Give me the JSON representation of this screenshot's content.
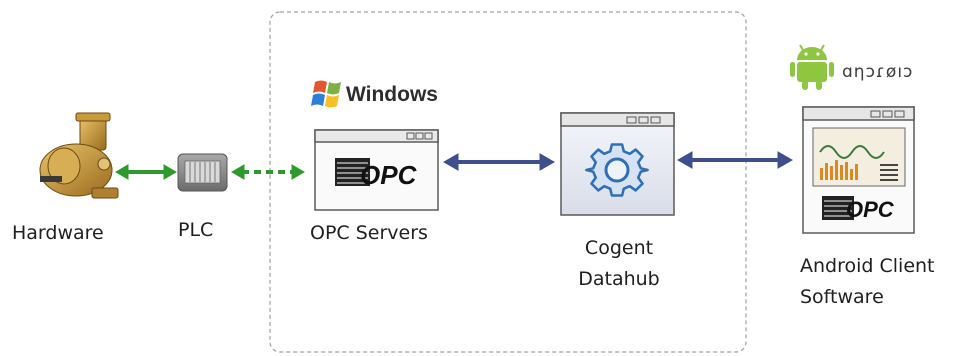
{
  "labels": {
    "hardware": "Hardware",
    "plc": "PLC",
    "opc_servers": "OPC Servers",
    "cogent_line1": "Cogent",
    "cogent_line2": "Datahub",
    "android_line1": "Android Client",
    "android_line2": "Software"
  },
  "logos": {
    "windows": "Windows",
    "android": "ɑηɔɾøıɔ",
    "opc": "OPC"
  },
  "colors": {
    "green_arrow": "#2e9a2e",
    "blue_arrow": "#3d4f8c",
    "dashed_border": "#9a9a9a",
    "android_green": "#8dc63f"
  },
  "icons": [
    "hardware-pump-icon",
    "plc-icon",
    "windows-logo-icon",
    "opc-server-window-icon",
    "gear-window-icon",
    "android-robot-icon",
    "android-client-window-icon"
  ]
}
